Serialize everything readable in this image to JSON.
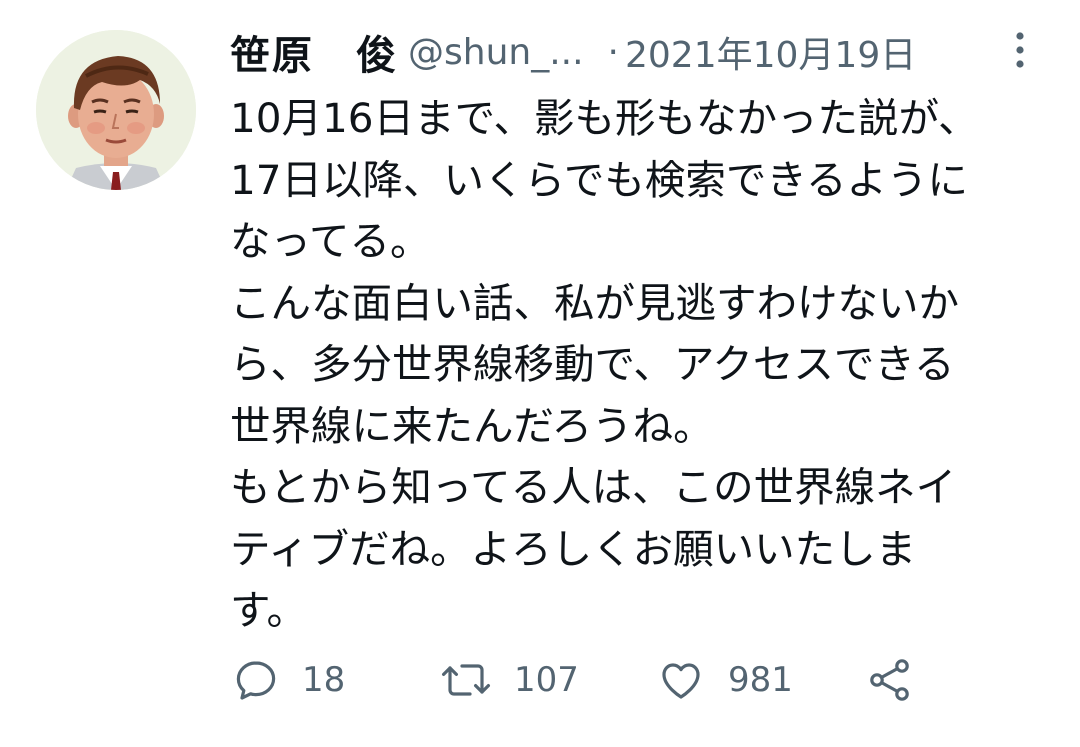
{
  "tweet": {
    "display_name": "笹原　俊",
    "handle": "@shun_...",
    "separator": "·",
    "date": "2021年10月19日",
    "text": "10月16日まで、影も形もなかった説が、\n17日以降、いくらでも検索できるように\nなってる。\nこんな面白い話、私が見逃すわけないか\nら、多分世界線移動で、アクセスできる\n世界線に来たんだろうね。\nもとから知ってる人は、この世界線ネイ\nティブだね。よろしくお願いいたしま\nす。"
  },
  "actions": {
    "reply": {
      "icon": "reply-icon",
      "count": "18"
    },
    "retweet": {
      "icon": "retweet-icon",
      "count": "107"
    },
    "like": {
      "icon": "heart-icon",
      "count": "981"
    },
    "share": {
      "icon": "share-icon"
    }
  },
  "colors": {
    "text_primary": "#0f1419",
    "text_secondary": "#536471",
    "background": "#ffffff"
  }
}
